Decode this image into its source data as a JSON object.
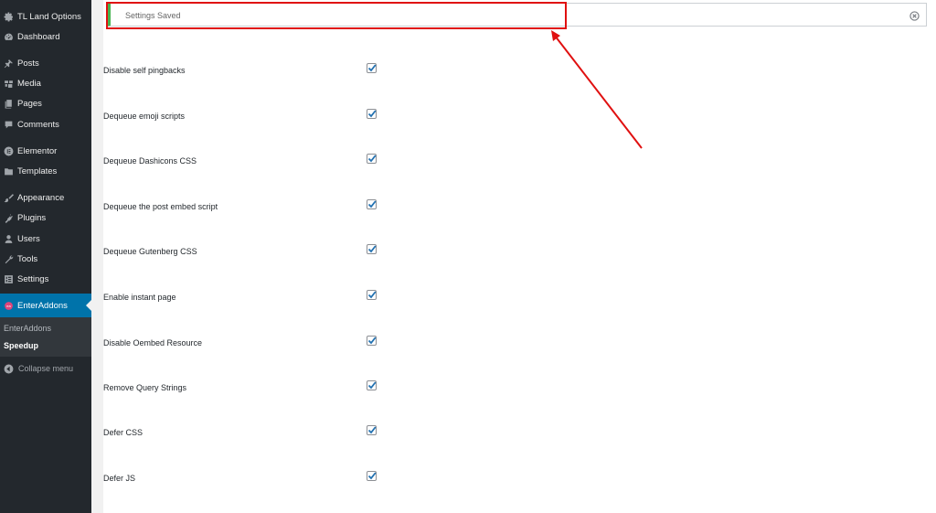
{
  "sidebar": {
    "items": [
      {
        "label": "TL Land Options",
        "icon": "gear-icon"
      },
      {
        "label": "Dashboard",
        "icon": "dashboard-icon"
      },
      {
        "label": "Posts",
        "icon": "pin-icon"
      },
      {
        "label": "Media",
        "icon": "media-icon"
      },
      {
        "label": "Pages",
        "icon": "pages-icon"
      },
      {
        "label": "Comments",
        "icon": "comment-icon"
      },
      {
        "label": "Elementor",
        "icon": "elementor-icon"
      },
      {
        "label": "Templates",
        "icon": "folder-icon"
      },
      {
        "label": "Appearance",
        "icon": "brush-icon"
      },
      {
        "label": "Plugins",
        "icon": "plug-icon"
      },
      {
        "label": "Users",
        "icon": "user-icon"
      },
      {
        "label": "Tools",
        "icon": "wrench-icon"
      },
      {
        "label": "Settings",
        "icon": "settings-icon"
      },
      {
        "label": "EnterAddons",
        "icon": "enteraddons-icon"
      }
    ],
    "submenu": [
      {
        "label": "EnterAddons"
      },
      {
        "label": "Speedup"
      }
    ],
    "collapse_label": "Collapse menu",
    "active_color": "#0073aa"
  },
  "notice": {
    "text": "Settings Saved",
    "border_color": "#46b450"
  },
  "settings": [
    {
      "label": "Disable self pingbacks",
      "checked": true
    },
    {
      "label": "Dequeue emoji scripts",
      "checked": true
    },
    {
      "label": "Dequeue Dashicons CSS",
      "checked": true
    },
    {
      "label": "Dequeue the post embed script",
      "checked": true
    },
    {
      "label": "Dequeue Gutenberg CSS",
      "checked": true
    },
    {
      "label": "Enable instant page",
      "checked": true
    },
    {
      "label": "Disable Oembed Resource",
      "checked": true
    },
    {
      "label": "Remove Query Strings",
      "checked": true
    },
    {
      "label": "Defer CSS",
      "checked": true
    },
    {
      "label": "Defer JS",
      "checked": true
    }
  ],
  "annotation_color": "#e01010"
}
